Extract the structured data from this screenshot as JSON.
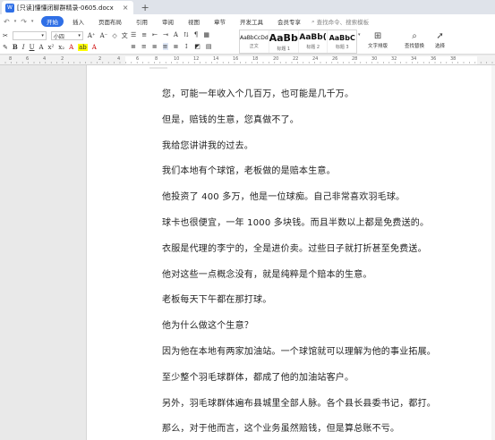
{
  "titlebar": {
    "app_badge": "W",
    "doc_title": "[只读]懂懂闭聊群精录-0605.docx",
    "close_glyph": "×",
    "add_glyph": "+"
  },
  "menubar": {
    "items": [
      "开始",
      "插入",
      "页面布局",
      "引用",
      "审阅",
      "视图",
      "章节",
      "开发工具",
      "会员专享"
    ],
    "search_placeholder": "查找命令、搜索模板"
  },
  "ribbon": {
    "font_name": "",
    "font_size": "小四",
    "styles": [
      {
        "preview": "AaBbCcDd",
        "label": "正文"
      },
      {
        "preview": "AaBb",
        "label": "标题 1"
      },
      {
        "preview": "AaBb(",
        "label": "标题 2"
      },
      {
        "preview": "AaBbC",
        "label": "标题 3"
      }
    ],
    "tools": {
      "text_layout": "文字排版",
      "find_replace": "查找替换",
      "select": "选择"
    }
  },
  "ruler": {
    "numbers": [
      "8",
      "6",
      "4",
      "2",
      "2",
      "4",
      "6",
      "8",
      "10",
      "12",
      "14",
      "16",
      "18",
      "20",
      "22",
      "24",
      "26",
      "28",
      "30",
      "32",
      "34",
      "36",
      "38"
    ]
  },
  "document": {
    "paragraphs": [
      "您，可能一年收入个几百万，也可能是几千万。",
      "但是，赔钱的生意，您真做不了。",
      "我给您讲讲我的过去。",
      "我们本地有个球馆，老板做的是赔本生意。",
      "他投资了 400 多万，他是一位球痴。自己非常喜欢羽毛球。",
      "球卡也很便宜，一年 1000 多块钱。而且半数以上都是免费送的。",
      "衣服是代理的李宁的，全是进价卖。过些日子就打折甚至免费送。",
      "他对这些一点概念没有，就是纯粹是个赔本的生意。",
      "老板每天下午都在那打球。",
      "他为什么做这个生意？",
      "因为他在本地有两家加油站。一个球馆就可以理解为他的事业拓展。",
      "至少整个羽毛球群体，都成了他的加油站客户。",
      "另外，羽毛球群体遍布县城里全部人脉。各个县长县委书记，都打。",
      "那么，对于他而言，这个业务虽然赔钱，但是算总账不亏。"
    ]
  }
}
